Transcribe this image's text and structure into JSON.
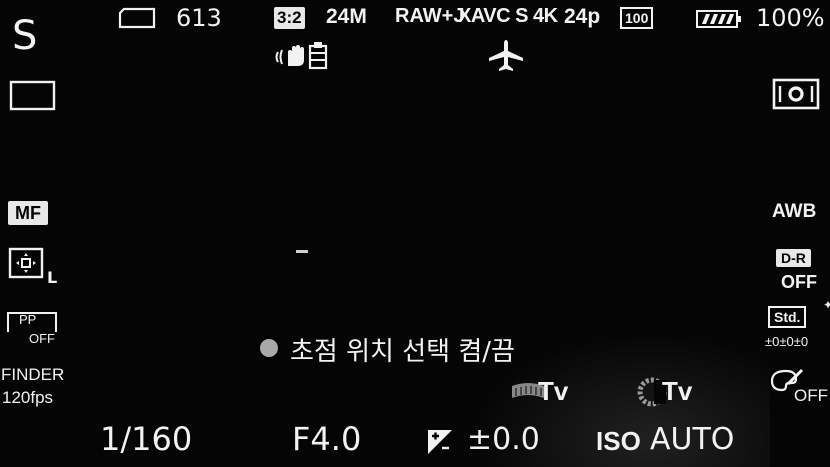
{
  "top": {
    "mode": "S",
    "shots_remaining": "613",
    "aspect_ratio": "3:2",
    "image_size": "24M",
    "file_format": "RAW+J",
    "movie_format": "XAVC S 4K",
    "frame_rate": "24p",
    "bitrate": "100",
    "battery_percent": "100%"
  },
  "left": {
    "focus_mode": "MF",
    "picture_profile_pp": "PP",
    "picture_profile_state": "OFF",
    "finder_label": "FINDER",
    "finder_fps": "120fps",
    "focus_area_suffix": "L"
  },
  "right": {
    "white_balance": "AWB",
    "dro_label": "D-R",
    "dro_state": "OFF",
    "creative_style": "Std.",
    "creative_style_values": "±0±0±0",
    "picture_effect_state": "OFF"
  },
  "center": {
    "message": "초점 위치 선택 켬/끔"
  },
  "dials": {
    "front_dial_label": "Tv",
    "rear_dial_label": "Tv"
  },
  "bottom": {
    "shutter_speed": "1/160",
    "aperture": "F4.0",
    "exposure_comp": "±0.0",
    "iso_label": "ISO",
    "iso_value": "AUTO"
  },
  "icons": [
    "memory-card-icon",
    "steadyshot-icon",
    "airplane-mode-icon",
    "battery-icon",
    "drive-mode-single-icon",
    "metering-multi-icon",
    "focus-area-icon",
    "dial-icon",
    "exposure-comp-icon",
    "picture-effect-icon"
  ],
  "colors": {
    "text": "#f2f2f2",
    "background": "#050505",
    "inverse_box": "#e8e8e8"
  }
}
